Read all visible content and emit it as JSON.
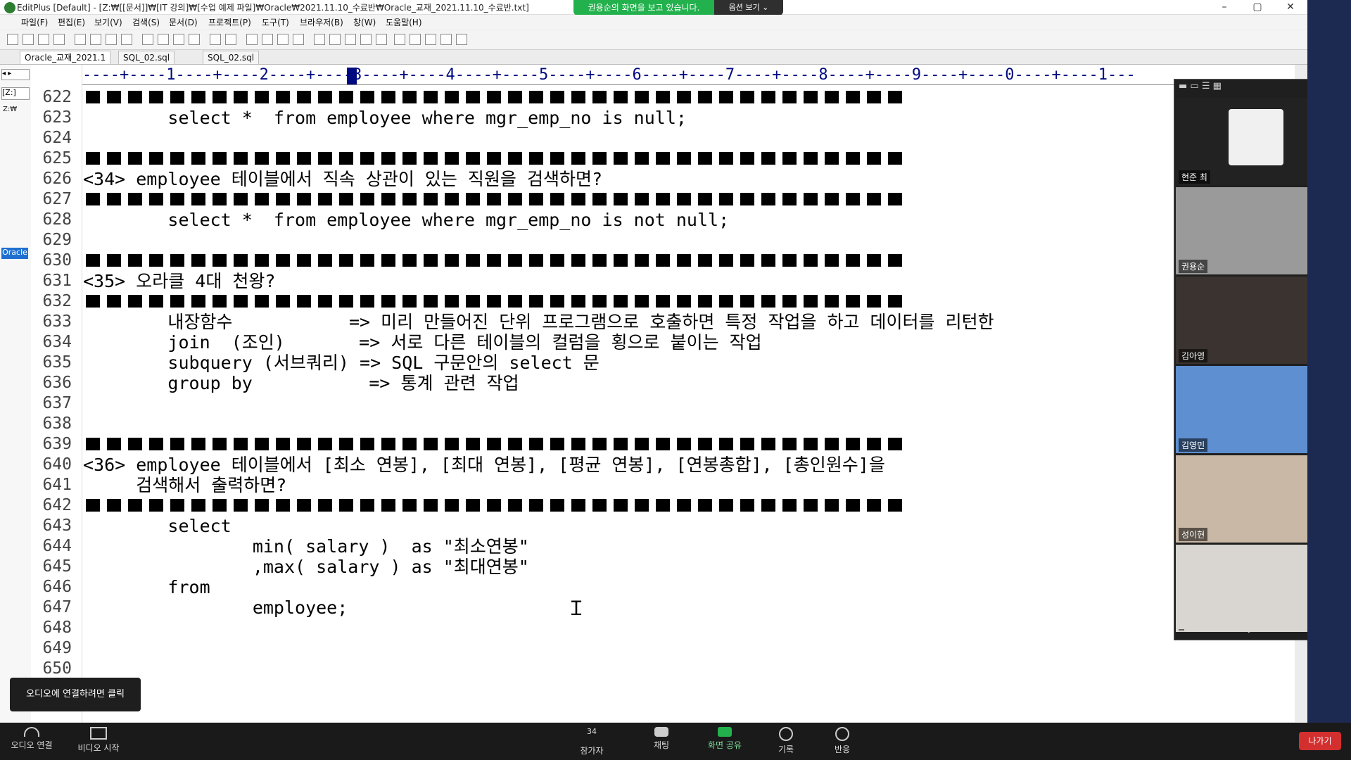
{
  "window": {
    "title": "EditPlus [Default] - [Z:₩[[문서]]₩[IT 강의]₩[수업 예제 파일]₩Oracle₩2021.11.10_수료반₩Oracle_교재_2021.11.10_수료반.txt]",
    "minimize": "–",
    "restore": "▢",
    "close": "✕"
  },
  "share_banner": {
    "text": "권용순의 화면을 보고 있습니다.",
    "view_options": "옵션 보기 ⌄"
  },
  "menu": [
    "파일(F)",
    "편집(E)",
    "보기(V)",
    "검색(S)",
    "문서(D)",
    "프로젝트(P)",
    "도구(T)",
    "브라우저(B)",
    "창(W)",
    "도움말(H)"
  ],
  "tabs": [
    "Oracle_교재_2021.1",
    "SQL_02.sql",
    "SQL_02.sql"
  ],
  "left_panel": {
    "drive": "[Z:]",
    "tree_root": "Z:₩",
    "project_label": "Oracle"
  },
  "ruler": "----+----1----+----2----+----3----+----4----+----5----+----6----+----7----+----8----+----9----+----0----+----1---",
  "editor_lines": [
    {
      "n": "622",
      "sep": true,
      "text": ""
    },
    {
      "n": "623",
      "sep": false,
      "text": "        select *  from employee where mgr_emp_no is null;"
    },
    {
      "n": "624",
      "sep": false,
      "text": ""
    },
    {
      "n": "625",
      "sep": true,
      "text": ""
    },
    {
      "n": "626",
      "sep": false,
      "text": "<34> employee 테이블에서 직속 상관이 있는 직원을 검색하면?"
    },
    {
      "n": "627",
      "sep": true,
      "text": ""
    },
    {
      "n": "628",
      "sep": false,
      "text": "        select *  from employee where mgr_emp_no is not null;"
    },
    {
      "n": "629",
      "sep": false,
      "text": ""
    },
    {
      "n": "630",
      "sep": true,
      "text": ""
    },
    {
      "n": "631",
      "sep": false,
      "text": "<35> 오라클 4대 천왕?"
    },
    {
      "n": "632",
      "sep": true,
      "text": ""
    },
    {
      "n": "633",
      "sep": false,
      "text": "        내장함수           => 미리 만들어진 단위 프로그램으로 호출하면 특정 작업을 하고 데이터를 리턴한"
    },
    {
      "n": "634",
      "sep": false,
      "text": "        join  (조인)       => 서로 다른 테이블의 컬럼을 횡으로 붙이는 작업"
    },
    {
      "n": "635",
      "sep": false,
      "text": "        subquery (서브쿼리) => SQL 구문안의 select 문"
    },
    {
      "n": "636",
      "sep": false,
      "text": "        group by           => 통계 관련 작업"
    },
    {
      "n": "637",
      "sep": false,
      "text": ""
    },
    {
      "n": "638",
      "sep": false,
      "text": ""
    },
    {
      "n": "639",
      "sep": true,
      "text": ""
    },
    {
      "n": "640",
      "sep": false,
      "text": "<36> employee 테이블에서 [최소 연봉], [최대 연봉], [평균 연봉], [연봉총합], [총인원수]을"
    },
    {
      "n": "641",
      "sep": false,
      "text": "     검색해서 출력하면?"
    },
    {
      "n": "642",
      "sep": true,
      "text": ""
    },
    {
      "n": "643",
      "sep": false,
      "text": "        select"
    },
    {
      "n": "644",
      "sep": false,
      "text": "                min( salary )  as \"최소연봉\""
    },
    {
      "n": "645",
      "sep": false,
      "text": "                ,max( salary ) as \"최대연봉\""
    },
    {
      "n": "646",
      "sep": false,
      "text": "        from"
    },
    {
      "n": "647",
      "sep": false,
      "text": "                employee;"
    },
    {
      "n": "648",
      "sep": false,
      "text": ""
    },
    {
      "n": "649",
      "sep": false,
      "text": ""
    },
    {
      "n": "650",
      "sep": false,
      "text": ""
    }
  ],
  "participants": [
    {
      "name": "현준 최",
      "bg": "#222222"
    },
    {
      "name": "권용순",
      "bg": "#9a9a9a"
    },
    {
      "name": "김아영",
      "bg": "#3a3330"
    },
    {
      "name": "김영민",
      "bg": "#5d8fd1"
    },
    {
      "name": "성이현",
      "bg": "#c9b8a5"
    },
    {
      "name": "",
      "bg": "#d9d6d2"
    }
  ],
  "audio_tooltip": "오디오에 연결하려면 클릭",
  "bottom_bar": {
    "audio": "오디오 연결",
    "video": "비디오 시작",
    "participants": "참가자",
    "participant_count": "34",
    "chat": "채팅",
    "share": "화면 공유",
    "record": "기록",
    "reactions": "반응",
    "leave": "나가기"
  },
  "colors": {
    "ruler": "#000a80",
    "share_green": "#22b14c",
    "leave_red": "#d32f2f",
    "zoom_bar": "#1a1a1a"
  }
}
